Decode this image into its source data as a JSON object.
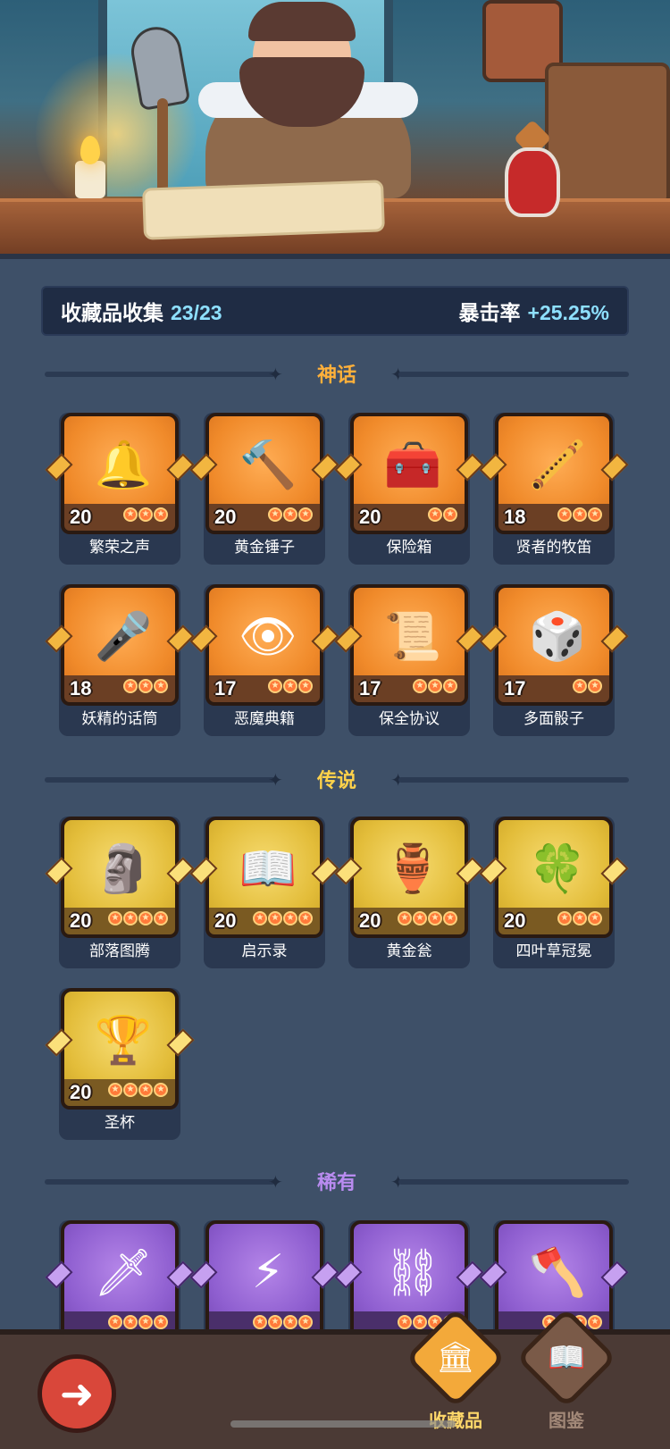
{
  "summary": {
    "collection_label": "收藏品收集",
    "collection_value": "23/23",
    "crit_label": "暴击率",
    "crit_value": "+25.25%"
  },
  "sections": {
    "mythic": {
      "title": "神话",
      "color": "#ffb03a",
      "items": [
        {
          "name": "繁荣之声",
          "level": "20",
          "stars": 3,
          "icon": "bell-icon"
        },
        {
          "name": "黄金锤子",
          "level": "20",
          "stars": 3,
          "icon": "hammer-icon"
        },
        {
          "name": "保险箱",
          "level": "20",
          "stars": 2,
          "icon": "treasure-chest-icon"
        },
        {
          "name": "贤者的牧笛",
          "level": "18",
          "stars": 3,
          "icon": "flute-icon"
        },
        {
          "name": "妖精的话筒",
          "level": "18",
          "stars": 3,
          "icon": "microphone-icon"
        },
        {
          "name": "恶魔典籍",
          "level": "17",
          "stars": 3,
          "icon": "demon-book-icon"
        },
        {
          "name": "保全协议",
          "level": "17",
          "stars": 3,
          "icon": "scroll-icon"
        },
        {
          "name": "多面骰子",
          "level": "17",
          "stars": 2,
          "icon": "dice-icon"
        }
      ]
    },
    "legend": {
      "title": "传说",
      "color": "#ffd24a",
      "items": [
        {
          "name": "部落图腾",
          "level": "20",
          "stars": 4,
          "icon": "totem-icon"
        },
        {
          "name": "启示录",
          "level": "20",
          "stars": 4,
          "icon": "open-book-icon"
        },
        {
          "name": "黄金瓮",
          "level": "20",
          "stars": 4,
          "icon": "urn-icon"
        },
        {
          "name": "四叶草冠冕",
          "level": "20",
          "stars": 3,
          "icon": "clover-crown-icon"
        },
        {
          "name": "圣杯",
          "level": "20",
          "stars": 4,
          "icon": "grail-icon"
        }
      ]
    },
    "rare": {
      "title": "稀有",
      "color": "#b98bf0",
      "items": [
        {
          "name": "",
          "level": "",
          "stars": 4,
          "icon": "ice-dagger-icon"
        },
        {
          "name": "",
          "level": "",
          "stars": 4,
          "icon": "lightning-gem-icon"
        },
        {
          "name": "",
          "level": "",
          "stars": 4,
          "icon": "vine-shackles-icon"
        },
        {
          "name": "",
          "level": "",
          "stars": 4,
          "icon": "axe-icon"
        }
      ]
    }
  },
  "nav": {
    "collection_label": "收藏品",
    "codex_label": "图鉴"
  }
}
